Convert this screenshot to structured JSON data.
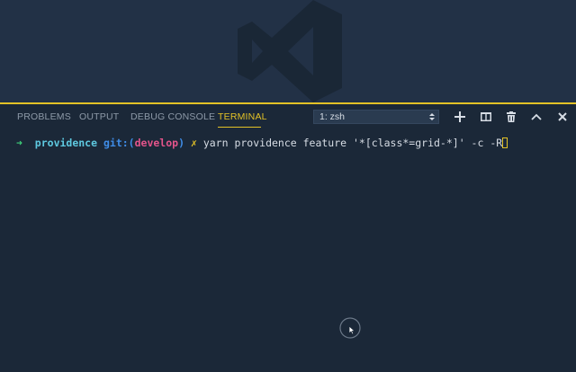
{
  "panel": {
    "tabs": [
      {
        "label": "PROBLEMS"
      },
      {
        "label": "OUTPUT"
      },
      {
        "label": "DEBUG CONSOLE"
      },
      {
        "label": "TERMINAL",
        "active": true
      }
    ],
    "terminal_select": {
      "value": "1: zsh"
    },
    "actions": [
      "plus-icon",
      "split-terminal-icon",
      "trash-icon",
      "chevron-up-icon",
      "close-icon"
    ]
  },
  "terminal": {
    "prompt_arrow": "➜",
    "host": "providence",
    "git_prefix": "git:(",
    "branch": "develop",
    "git_suffix": ")",
    "dirty_marker": "✗",
    "command": "yarn providence feature '*[class*=grid-*]' -c -R"
  },
  "colors": {
    "accent": "#e3c227",
    "prompt_arrow": "#3ed17a",
    "host": "#5ec9e0",
    "git": "#3f8de8",
    "branch": "#e4548b",
    "panel_bg": "#1b2838",
    "editor_bg": "#223146"
  }
}
